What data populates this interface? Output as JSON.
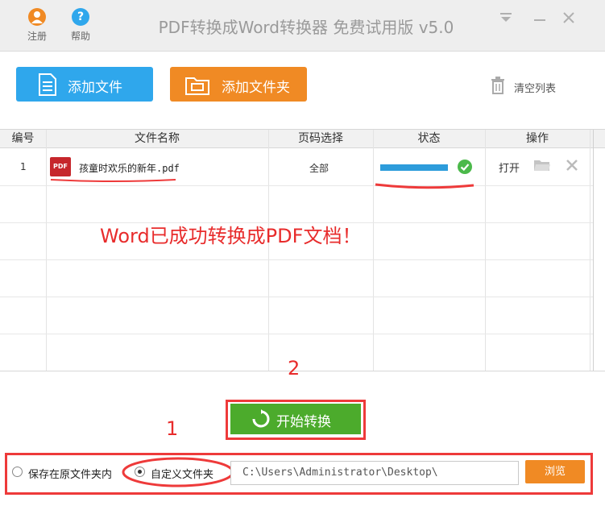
{
  "titlebar": {
    "title": "PDF转换成Word转换器 免费试用版 v5.0",
    "register_label": "注册",
    "help_label": "帮助"
  },
  "toolbar": {
    "add_file_label": "添加文件",
    "add_folder_label": "添加文件夹",
    "clear_list_label": "清空列表"
  },
  "table": {
    "headers": [
      "编号",
      "文件名称",
      "页码选择",
      "状态",
      "操作"
    ],
    "rows": [
      {
        "index": "1",
        "file_name": "孩童时欢乐的新年.pdf",
        "pages": "全部",
        "progress": 1.0,
        "open_label": "打开"
      }
    ]
  },
  "overlay_message": "Word已成功转换成PDF文档！",
  "annotations": [
    "1",
    "2"
  ],
  "start_button_label": "开始转换",
  "output": {
    "save_original_label": "保存在原文件夹内",
    "custom_folder_label": "自定义文件夹",
    "selected": "custom",
    "path_value": "C:\\Users\\Administrator\\Desktop\\",
    "browse_label": "浏览"
  },
  "colors": {
    "add_file_bg": "#2fa7ec",
    "add_folder_bg": "#f08a24",
    "start_bg": "#4cab2c",
    "annotation_red": "#e82c2c",
    "progress": "#2d9cdb"
  }
}
